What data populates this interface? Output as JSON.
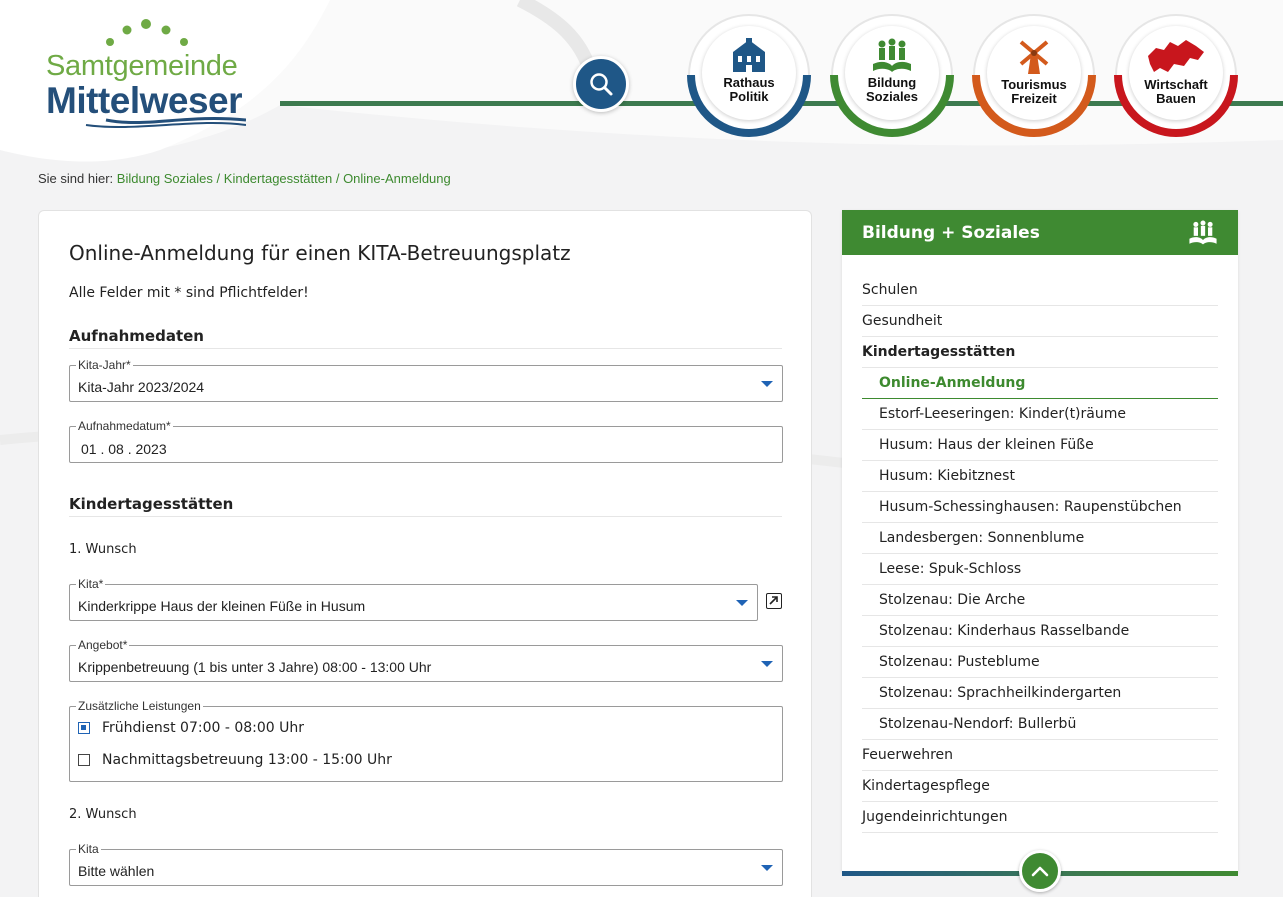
{
  "logo": {
    "line1": "Samtgemeinde",
    "line2": "Mittelweser"
  },
  "nav": [
    {
      "line1": "Rathaus",
      "line2": "Politik",
      "color": "#1f5787"
    },
    {
      "line1": "Bildung",
      "line2": "Soziales",
      "color": "#3f8a32"
    },
    {
      "line1": "Tourismus",
      "line2": "Freizeit",
      "color": "#d35a1c"
    },
    {
      "line1": "Wirtschaft",
      "line2": "Bauen",
      "color": "#c8161d"
    }
  ],
  "breadcrumb": {
    "prefix": "Sie sind hier:",
    "items": [
      "Bildung Soziales",
      "Kindertagesstätten",
      "Online-Anmeldung"
    ],
    "separator": "/"
  },
  "form": {
    "title": "Online-Anmeldung für einen KITA-Betreuungsplatz",
    "required_note": "Alle Felder mit * sind Pflichtfelder!",
    "section_aufnahme": "Aufnahmedaten",
    "kita_jahr": {
      "label": "Kita-Jahr*",
      "value": "Kita-Jahr 2023/2024"
    },
    "aufnahmedatum": {
      "label": "Aufnahmedatum*",
      "value": "01 . 08 . 2023"
    },
    "section_kitas": "Kindertagesstätten",
    "wunsch1": {
      "heading": "1. Wunsch",
      "kita": {
        "label": "Kita*",
        "value": "Kinderkrippe Haus der kleinen Füße in Husum"
      },
      "angebot": {
        "label": "Angebot*",
        "value": "Krippenbetreuung (1 bis unter 3 Jahre) 08:00 - 13:00 Uhr"
      },
      "zusatz": {
        "label": "Zusätzliche Leistungen",
        "options": [
          {
            "label": "Frühdienst 07:00 - 08:00 Uhr",
            "checked": true
          },
          {
            "label": "Nachmittagsbetreuung 13:00 - 15:00 Uhr",
            "checked": false
          }
        ]
      }
    },
    "wunsch2": {
      "heading": "2. Wunsch",
      "kita": {
        "label": "Kita",
        "value": "Bitte wählen"
      }
    }
  },
  "sidebar": {
    "title": "Bildung + Soziales",
    "items": [
      {
        "label": "Schulen",
        "level": "top"
      },
      {
        "label": "Gesundheit",
        "level": "top"
      },
      {
        "label": "Kindertagesstätten",
        "level": "top-bold"
      },
      {
        "label": "Online-Anmeldung",
        "level": "active"
      },
      {
        "label": "Estorf-Leeseringen: Kinder(t)räume",
        "level": "sub"
      },
      {
        "label": "Husum: Haus der kleinen Füße",
        "level": "sub"
      },
      {
        "label": "Husum: Kiebitznest",
        "level": "sub"
      },
      {
        "label": "Husum-Schessinghausen: Raupenstübchen",
        "level": "sub"
      },
      {
        "label": "Landesbergen: Sonnenblume",
        "level": "sub"
      },
      {
        "label": "Leese: Spuk-Schloss",
        "level": "sub"
      },
      {
        "label": "Stolzenau: Die Arche",
        "level": "sub"
      },
      {
        "label": "Stolzenau: Kinderhaus Rasselbande",
        "level": "sub"
      },
      {
        "label": "Stolzenau: Pusteblume",
        "level": "sub"
      },
      {
        "label": "Stolzenau: Sprachheilkindergarten",
        "level": "sub"
      },
      {
        "label": "Stolzenau-Nendorf: Bullerbü",
        "level": "sub"
      },
      {
        "label": "Feuerwehren",
        "level": "top"
      },
      {
        "label": "Kindertagespflege",
        "level": "top"
      },
      {
        "label": "Jugendeinrichtungen",
        "level": "top"
      }
    ]
  },
  "colors": {
    "brand_green": "#3f8a32",
    "brand_blue": "#1f5787",
    "link_green": "#3d8a2f",
    "select_caret": "#1f63b5"
  }
}
